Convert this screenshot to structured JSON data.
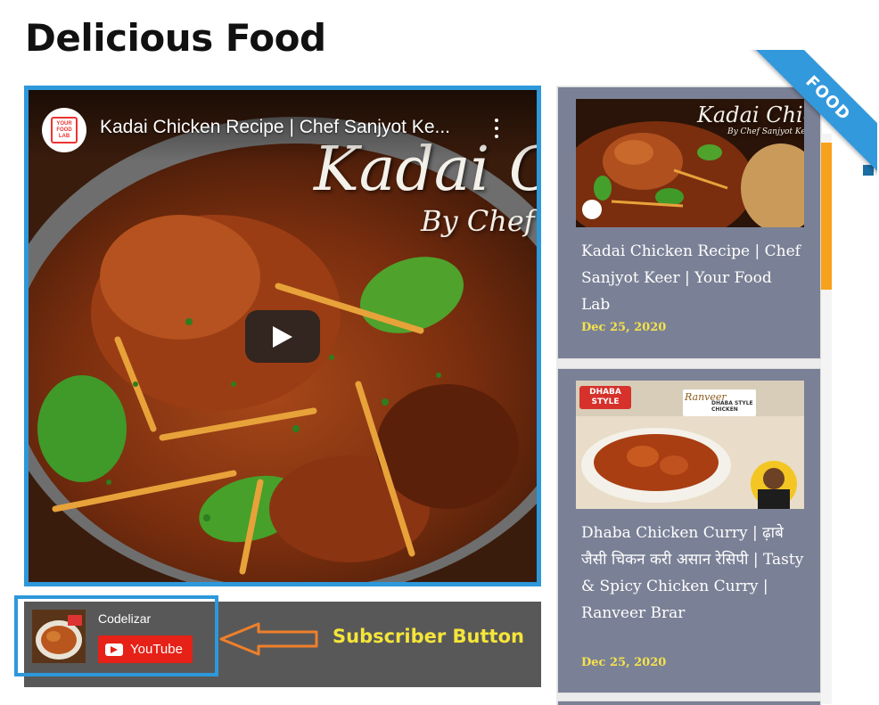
{
  "page": {
    "title": "Delicious Food"
  },
  "video": {
    "title": "Kadai Chicken Recipe | Chef Sanjyot Ke...",
    "channel_logo_text": "YOUR FOOD LAB",
    "overlay_script_1": "Kadai C",
    "overlay_script_2": "By Chef S"
  },
  "subscriber": {
    "channel_name": "Codelizar",
    "button_label": "YouTube",
    "annotation": "Subscriber Button"
  },
  "ribbon": {
    "label": "FOOD"
  },
  "sidebar": {
    "cards": [
      {
        "title": "Kadai Chicken Recipe | Chef Sanjyot Keer | Your Food Lab",
        "date": "Dec 25, 2020",
        "thumb_script_1": "Kadai Chicken",
        "thumb_script_2": "By Chef Sanjyot Keer"
      },
      {
        "title": "Dhaba Chicken Curry | ढ़ाबे जैसी चिकन करी असान रेसिपी | Tasty & Spicy Chicken Curry | Ranveer Brar",
        "date": "Dec 25, 2020",
        "thumb_badge": "DHABA STYLE",
        "thumb_caption": "DHABA STYLE CHICKEN",
        "thumb_brand": "Ranveer"
      }
    ]
  },
  "colors": {
    "accent_blue": "#2d98da",
    "card_bg": "#7a8196",
    "date_yellow": "#f6e24b",
    "annotation_yellow": "#f5e53a",
    "annotation_arrow": "#ef7f2a",
    "youtube_red": "#e62117",
    "scroll_orange": "#f7a21b"
  },
  "icons": [
    "play-icon",
    "more-vert-icon",
    "youtube-icon",
    "left-arrow-icon"
  ]
}
